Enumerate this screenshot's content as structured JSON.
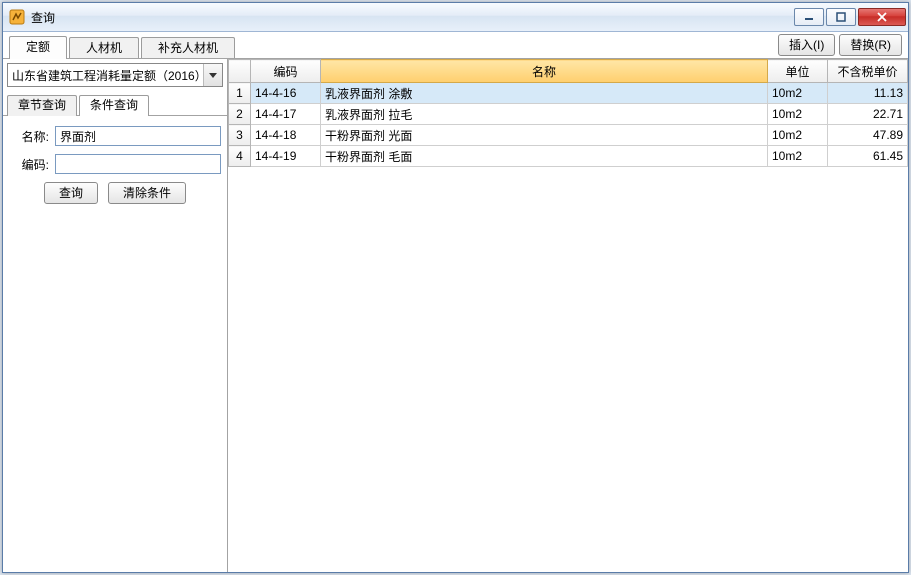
{
  "window": {
    "title": "查询"
  },
  "main_tabs": [
    {
      "label": "定额",
      "active": true
    },
    {
      "label": "人材机",
      "active": false
    },
    {
      "label": "补充人材机",
      "active": false
    }
  ],
  "action_buttons": {
    "insert": "插入(I)",
    "replace": "替换(R)"
  },
  "dropdown": {
    "selected": "山东省建筑工程消耗量定额（2016）"
  },
  "sub_tabs": [
    {
      "label": "章节查询",
      "active": false
    },
    {
      "label": "条件查询",
      "active": true
    }
  ],
  "form": {
    "name_label": "名称:",
    "name_value": "界面剂",
    "code_label": "编码:",
    "code_value": "",
    "query_btn": "查询",
    "clear_btn": "清除条件"
  },
  "grid": {
    "columns": {
      "rownum": "",
      "code": "编码",
      "name": "名称",
      "unit": "单位",
      "price": "不含税单价"
    },
    "rows": [
      {
        "n": "1",
        "code": "14-4-16",
        "name": "乳液界面剂 涂敷",
        "unit": "10m2",
        "price": "11.13",
        "selected": true
      },
      {
        "n": "2",
        "code": "14-4-17",
        "name": "乳液界面剂 拉毛",
        "unit": "10m2",
        "price": "22.71",
        "selected": false
      },
      {
        "n": "3",
        "code": "14-4-18",
        "name": "干粉界面剂 光面",
        "unit": "10m2",
        "price": "47.89",
        "selected": false
      },
      {
        "n": "4",
        "code": "14-4-19",
        "name": "干粉界面剂 毛面",
        "unit": "10m2",
        "price": "61.45",
        "selected": false
      }
    ]
  }
}
